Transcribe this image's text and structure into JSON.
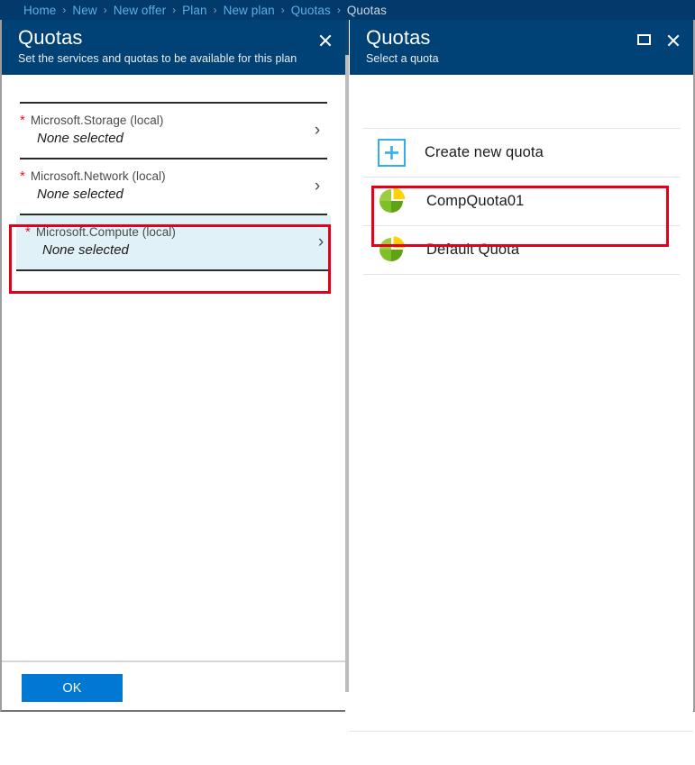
{
  "breadcrumb": {
    "separator": "›",
    "items": [
      {
        "label": "Home",
        "current": false
      },
      {
        "label": "New",
        "current": false
      },
      {
        "label": "New offer",
        "current": false
      },
      {
        "label": "Plan",
        "current": false
      },
      {
        "label": "New plan",
        "current": false
      },
      {
        "label": "Quotas",
        "current": false
      },
      {
        "label": "Quotas",
        "current": true
      }
    ]
  },
  "colors": {
    "header_blue": "#004275",
    "breadcrumb_blue": "#013A6B",
    "link_blue": "#5FAEE3",
    "accent_button": "#0078D4",
    "required_red": "#E81123",
    "annotation_red": "#E2001A",
    "selected_row": "#E1F1F8",
    "plus_border": "#32AEF0",
    "pie_yellow": "#FFD200",
    "pie_green_light": "#9BCC42",
    "pie_green_mid": "#7FBF29",
    "pie_green_dark": "#5FA214"
  },
  "left_blade": {
    "title": "Quotas",
    "subtitle": "Set the services and quotas to be available for this plan",
    "close_label": "Close",
    "chevron_glyph": "›",
    "required_marker": "*",
    "services": [
      {
        "name": "Microsoft.Storage (local)",
        "value": "None selected",
        "required": true,
        "selected": false
      },
      {
        "name": "Microsoft.Network (local)",
        "value": "None selected",
        "required": true,
        "selected": false
      },
      {
        "name": "Microsoft.Compute (local)",
        "value": "None selected",
        "required": true,
        "selected": true
      }
    ],
    "footer": {
      "ok_label": "OK"
    }
  },
  "right_blade": {
    "title": "Quotas",
    "subtitle": "Select a quota",
    "maximize_label": "Maximize",
    "close_label": "Close",
    "create_new": {
      "label": "Create new quota",
      "icon": "plus-icon"
    },
    "quotas": [
      {
        "label": "CompQuota01",
        "icon": "pie-chart-icon",
        "highlighted": true
      },
      {
        "label": "Default Quota",
        "icon": "pie-chart-icon",
        "highlighted": false
      }
    ]
  }
}
